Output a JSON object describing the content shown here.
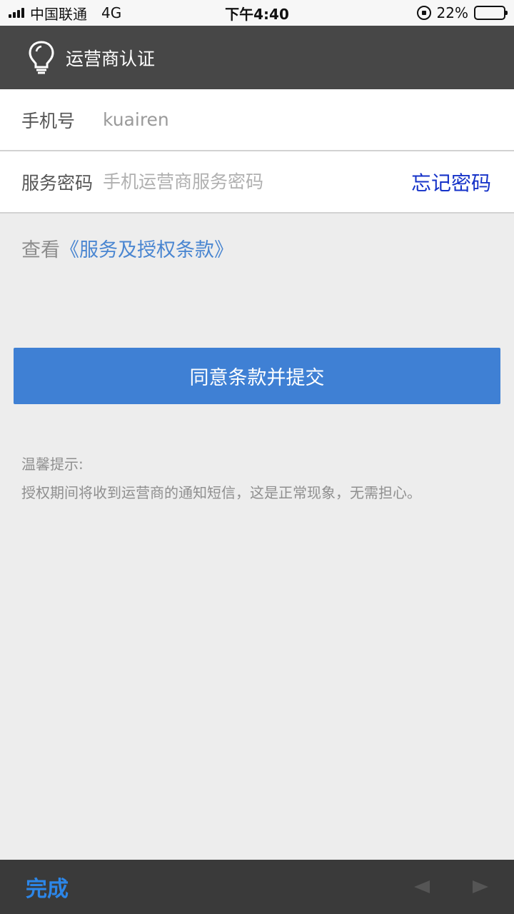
{
  "status_bar": {
    "carrier": "中国联通",
    "network": "4G",
    "time": "下午4:40",
    "battery_percent_text": "22%",
    "battery_level": 0.22
  },
  "header": {
    "title": "运营商认证",
    "icon": "lightbulb-icon"
  },
  "form": {
    "phone": {
      "label": "手机号",
      "value": "kuairen"
    },
    "password": {
      "label": "服务密码",
      "placeholder": "手机运营商服务密码",
      "forgot_label": "忘记密码"
    }
  },
  "terms": {
    "prefix": "查看",
    "link": "《服务及授权条款》"
  },
  "submit_label": "同意条款并提交",
  "tips": {
    "title": "温馨提示:",
    "body": "授权期间将收到运营商的通知短信，这是正常现象，无需担心。"
  },
  "toolbar": {
    "done_label": "完成",
    "prev_icon": "left-arrow-icon",
    "next_icon": "right-arrow-icon"
  },
  "colors": {
    "header_bg": "#474747",
    "primary_button": "#3f80d4",
    "link": "#4a86d1",
    "forgot": "#1532c8",
    "done": "#2c86e8"
  }
}
